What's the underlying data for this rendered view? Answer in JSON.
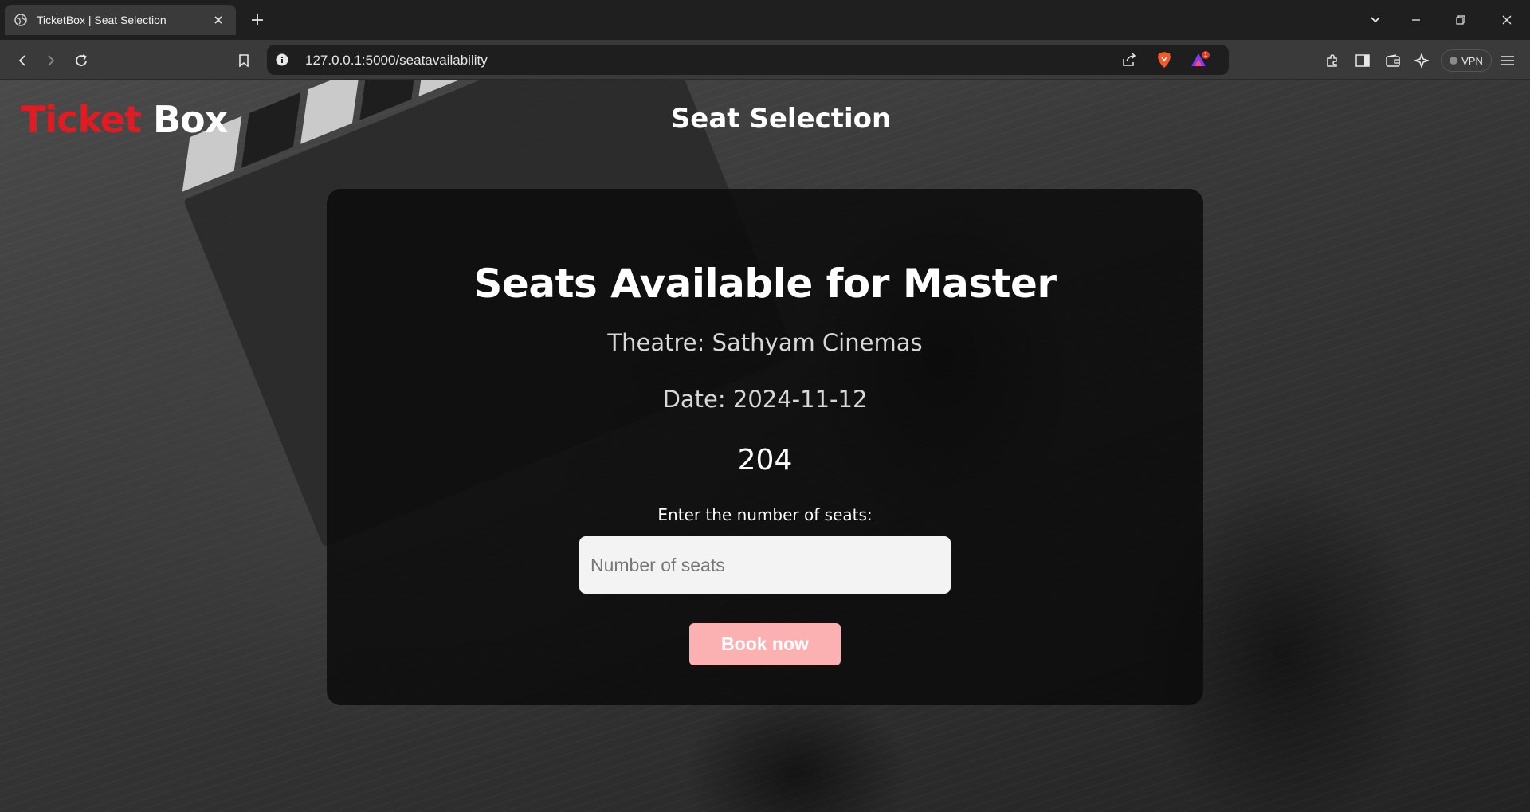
{
  "browser": {
    "tab_title": "TicketBox | Seat Selection",
    "url": "127.0.0.1:5000/seatavailability",
    "vpn_label": "VPN",
    "notification_count": "1"
  },
  "header": {
    "brand_first": "Ticket",
    "brand_second": "Box",
    "title": "Seat Selection"
  },
  "main": {
    "heading": "Seats Available for Master",
    "theatre": "Theatre: Sathyam Cinemas",
    "date": "Date: 2024-11-12",
    "seats_available": "204",
    "seats_label": "Enter the number of seats:",
    "seats_placeholder": "Number of seats",
    "book_button": "Book now"
  },
  "colors": {
    "brand_red": "#e01b22",
    "button_pink": "#fbb1b1",
    "card_bg": "#0a0a0a"
  }
}
